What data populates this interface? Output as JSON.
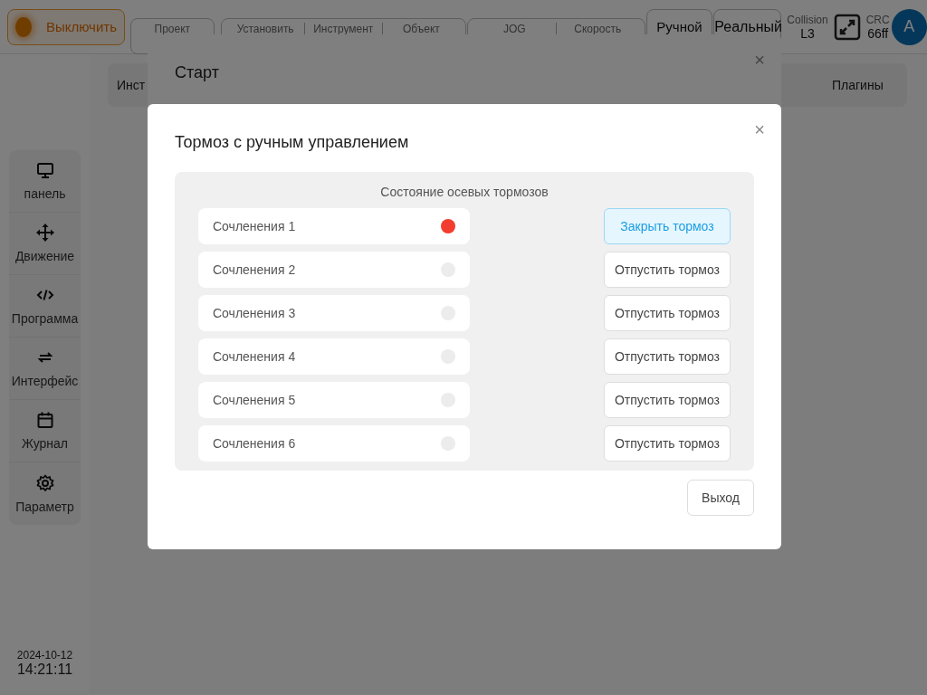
{
  "top_bar": {
    "power_button": {
      "label": "Выключить"
    },
    "status_groups": [
      [
        {
          "label": "Проект"
        }
      ],
      [
        {
          "label": "Установить"
        },
        {
          "label": "Инструмент"
        },
        {
          "label": "Объект"
        }
      ],
      [
        {
          "label": "JOG"
        },
        {
          "label": "Скорость"
        }
      ]
    ],
    "mode_buttons": [
      "Ручной",
      "Реальный"
    ],
    "collision": {
      "label": "Collision",
      "value": "L3"
    },
    "crc": {
      "label": "CRC",
      "value": "66ff"
    },
    "avatar": "A"
  },
  "sidebar": {
    "items": [
      {
        "label": "панель"
      },
      {
        "label": "Движение"
      },
      {
        "label": "Программа"
      },
      {
        "label": "Интерфейс"
      },
      {
        "label": "Журнал"
      },
      {
        "label": "Параметр"
      }
    ],
    "date": "2024-10-12",
    "time": "14:21:11"
  },
  "tabs": [
    "Инст",
    "Плагины"
  ],
  "start_dialog": {
    "title": "Старт",
    "close": "×"
  },
  "brake_dialog": {
    "title": "Тормоз с ручным управлением",
    "close": "×",
    "panel_title": "Состояние осевых тормозов",
    "joints": [
      {
        "name": "Сочленения 1",
        "released": true,
        "action": "Закрыть тормоз"
      },
      {
        "name": "Сочленения 2",
        "released": false,
        "action": "Отпустить тормоз"
      },
      {
        "name": "Сочленения 3",
        "released": false,
        "action": "Отпустить тормоз"
      },
      {
        "name": "Сочленения 4",
        "released": false,
        "action": "Отпустить тормоз"
      },
      {
        "name": "Сочленения 5",
        "released": false,
        "action": "Отпустить тормоз"
      },
      {
        "name": "Сочленения 6",
        "released": false,
        "action": "Отпустить тормоз"
      }
    ],
    "exit_button": "Выход"
  }
}
